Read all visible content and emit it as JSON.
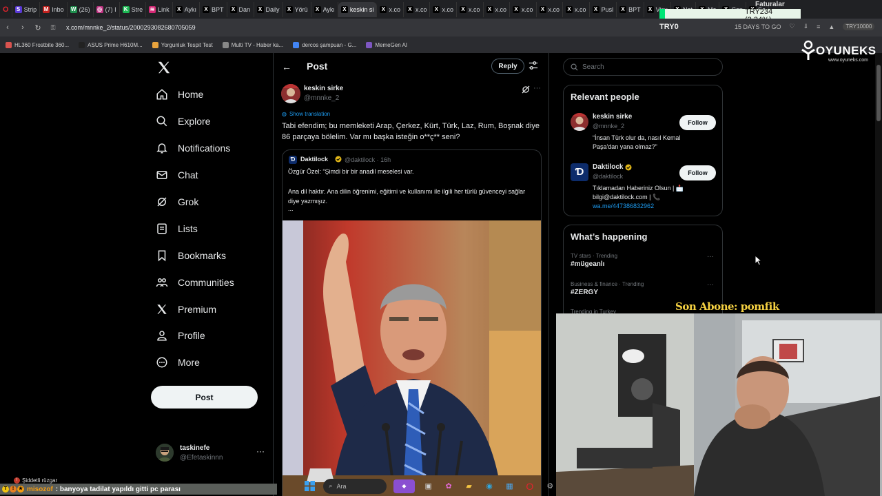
{
  "browser": {
    "tabs": [
      {
        "label": "Strip",
        "color": "#5a39d6",
        "glyph": "S"
      },
      {
        "label": "Inbo",
        "color": "#c5221f",
        "glyph": "M"
      },
      {
        "label": "(26)",
        "color": "#1f8f4e",
        "glyph": "W"
      },
      {
        "label": "(7) I",
        "color": "#c13584",
        "glyph": "◎"
      },
      {
        "label": "Stre",
        "color": "#1db954",
        "glyph": "K"
      },
      {
        "label": "Link",
        "color": "#d62976",
        "glyph": "≋"
      },
      {
        "label": "Aykı",
        "color": "#000000",
        "glyph": "X"
      },
      {
        "label": "BPT",
        "color": "#000000",
        "glyph": "X"
      },
      {
        "label": "Darı",
        "color": "#000000",
        "glyph": "X"
      },
      {
        "label": "Daily",
        "color": "#000000",
        "glyph": "X"
      },
      {
        "label": "Yörü",
        "color": "#000000",
        "glyph": "X"
      },
      {
        "label": "Aykı",
        "color": "#000000",
        "glyph": "X"
      },
      {
        "label": "keskin si",
        "color": "#000000",
        "glyph": "X",
        "active": true
      },
      {
        "label": "x.co",
        "color": "#000000",
        "glyph": "X"
      },
      {
        "label": "x.co",
        "color": "#000000",
        "glyph": "X"
      },
      {
        "label": "x.co",
        "color": "#000000",
        "glyph": "X"
      },
      {
        "label": "x.co",
        "color": "#000000",
        "glyph": "X"
      },
      {
        "label": "x.co",
        "color": "#000000",
        "glyph": "X"
      },
      {
        "label": "x.co",
        "color": "#000000",
        "glyph": "X"
      },
      {
        "label": "x.co",
        "color": "#000000",
        "glyph": "X"
      },
      {
        "label": "x.co",
        "color": "#000000",
        "glyph": "X"
      },
      {
        "label": "Pusl",
        "color": "#000000",
        "glyph": "X"
      },
      {
        "label": "BPT",
        "color": "#000000",
        "glyph": "X"
      },
      {
        "label": "Visu",
        "color": "#000000",
        "glyph": "X"
      },
      {
        "label": "Net",
        "color": "#000000",
        "glyph": "X"
      },
      {
        "label": "Mo",
        "color": "#000000",
        "glyph": "X"
      },
      {
        "label": "Con",
        "color": "#000000",
        "glyph": "X"
      },
      {
        "label": "Se",
        "color": "#000000",
        "glyph": "X"
      }
    ],
    "url": "x.com/mnnke_2/status/2000293082680705059",
    "faturalar": "Faturalar",
    "stock": "TRY234 (2.34%)",
    "try0": "TRY0",
    "days_to_go": "15 DAYS TO GO",
    "profile_badge": "TRY10000",
    "bookmarks": [
      {
        "label": "HL360 Frostbite 360...",
        "color": "#d9534f"
      },
      {
        "label": "ASUS Prime H610M...",
        "color": "#222222"
      },
      {
        "label": "Yorgunluk Tespit Test",
        "color": "#e8a33d"
      },
      {
        "label": "Multi TV - Haber ka...",
        "color": "#888888"
      },
      {
        "label": "dercos şampuan - G...",
        "color": "#4285f4"
      },
      {
        "label": "MemeGen AI",
        "color": "#7e57c2"
      }
    ]
  },
  "overlay": {
    "oyuneks_name": "OYUNEKS",
    "oyuneks_url": "www.oyuneks.com",
    "son_abone": "Son Abone: pomfik"
  },
  "sidebar": {
    "items": [
      {
        "label": "Home",
        "icon": "home-icon"
      },
      {
        "label": "Explore",
        "icon": "search-icon"
      },
      {
        "label": "Notifications",
        "icon": "bell-icon"
      },
      {
        "label": "Chat",
        "icon": "mail-icon"
      },
      {
        "label": "Grok",
        "icon": "grok-icon"
      },
      {
        "label": "Lists",
        "icon": "list-icon"
      },
      {
        "label": "Bookmarks",
        "icon": "bookmark-icon"
      },
      {
        "label": "Communities",
        "icon": "people-icon"
      },
      {
        "label": "Premium",
        "icon": "x-icon"
      },
      {
        "label": "Profile",
        "icon": "person-icon"
      },
      {
        "label": "More",
        "icon": "more-circle-icon"
      }
    ],
    "post_button": "Post",
    "account_name": "taskinefe",
    "account_handle": "@Efetaskinnn"
  },
  "main": {
    "header_title": "Post",
    "reply_label": "Reply",
    "author_name": "keskin sirke",
    "author_handle": "@mnnke_2",
    "show_translation": "Show translation",
    "text": "Tabi efendim; bu memleketi Arap, Çerkez, Kürt, Türk, Laz, Rum, Boşnak diye 86 parçaya bölelim. Var mı başka isteğin o**ç** seni?",
    "quote": {
      "name": "Daktilock",
      "handle": "@daktilock · 16h",
      "line1": "Özgür Özel: “Şimdi bir bir anadil meselesi var.",
      "line2": "Ana dil haktır. Ana dilin öğrenimi, eğitimi ve kullanımı ile ilgili her türlü güvenceyi sağlar diye yazmışız.",
      "ellipsis": "..."
    }
  },
  "right": {
    "search_placeholder": "Search",
    "relevant_title": "Relevant people",
    "people": [
      {
        "name": "keskin sirke",
        "handle": "@mnnke_2",
        "bio": "“İnsan Türk olur da, nasıl Kemal Paşa'dan yana olmaz?”",
        "follow": "Follow"
      },
      {
        "name": "Daktilock",
        "handle": "@daktilock",
        "bio": "Tıklamadan Haberiniz Olsun | 📩 bilgi@daktilock.com | 📞",
        "link": "wa.me/447386832962",
        "follow": "Follow"
      }
    ],
    "happening_title": "What’s happening",
    "trends": [
      {
        "meta": "TV stars · Trending",
        "title": "#mügeanlı"
      },
      {
        "meta": "Business & finance · Trending",
        "title": "#ZERGY"
      }
    ],
    "trend3_meta": "Trending in Turkey"
  },
  "stream": {
    "weather": "Şiddetli rüzgar",
    "chat_user": "misozof",
    "chat_message": ": banyoya tadilat yapıldı gitti pc parası",
    "taskbar_search": "Ara"
  }
}
